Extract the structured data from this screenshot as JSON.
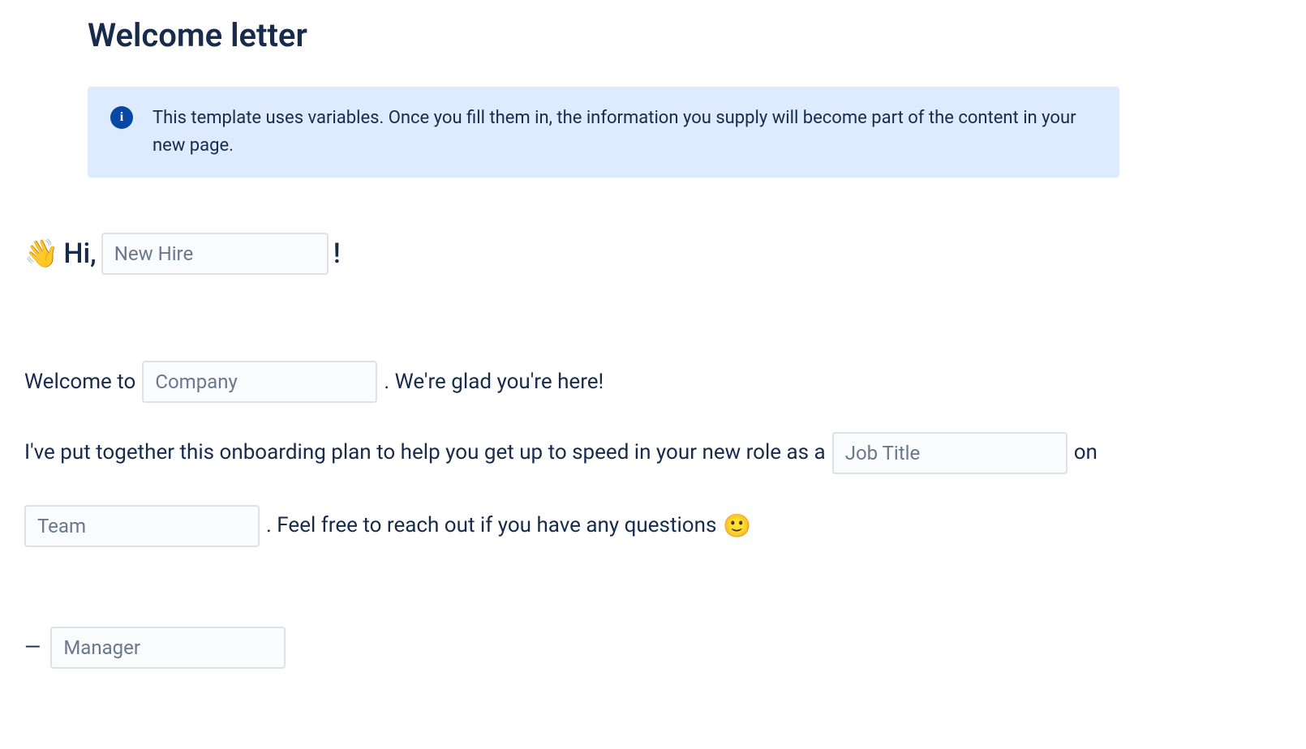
{
  "page": {
    "title": "Welcome letter"
  },
  "info": {
    "text": "This template uses variables. Once you fill them in, the information you supply will become part of the content in your new page."
  },
  "greeting": {
    "wave_emoji": "👋",
    "hi_text": "Hi,",
    "exclaim": "!",
    "new_hire_placeholder": "New Hire"
  },
  "body": {
    "welcome_to": "Welcome to",
    "company_placeholder": "Company",
    "glad_here": ". We're glad you're here!",
    "onboarding_intro": "I've put together this onboarding plan to help you get up to speed in your new role as a",
    "job_title_placeholder": "Job Title",
    "on_text": "on",
    "team_placeholder": "Team",
    "reach_out": ". Feel free to reach out if you have any questions",
    "smile_emoji": "🙂"
  },
  "signature": {
    "dash": "—",
    "manager_placeholder": "Manager"
  }
}
